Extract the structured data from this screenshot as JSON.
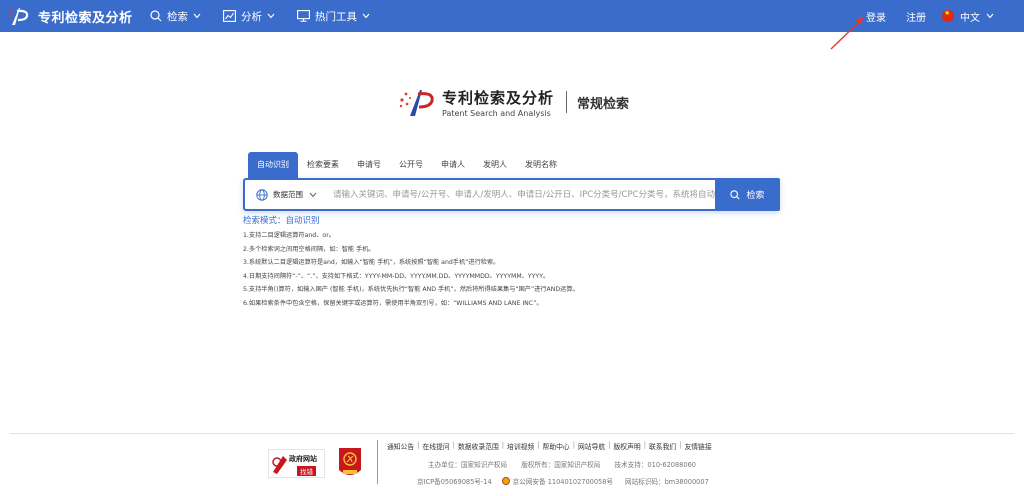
{
  "header": {
    "brand": "专利检索及分析",
    "nav": [
      {
        "label": "检索"
      },
      {
        "label": "分析"
      },
      {
        "label": "热门工具"
      }
    ],
    "login": "登录",
    "register": "注册",
    "language": "中文"
  },
  "logo": {
    "title_cn": "专利检索及分析",
    "title_en": "Patent Search and Analysis",
    "subtitle": "常规检索"
  },
  "tabs": [
    "自动识别",
    "检索要素",
    "申请号",
    "公开号",
    "申请人",
    "发明人",
    "发明名称"
  ],
  "search": {
    "scope_label": "数据范围",
    "placeholder": "请输入关键词、申请号/公开号、申请人/发明人、申请日/公开日、IPC分类号/CPC分类号，系统将自动识别",
    "button": "检索"
  },
  "mode": "检索模式：自动识别",
  "tips": [
    "1.支持二目逻辑运算符and、or。",
    "2.多个检索词之间用空格间隔，如：智能 手机。",
    "3.系统默认二目逻辑运算符是and，如输入“智能 手机”，系统按照“智能 and手机”进行检索。",
    "4.日期支持间隔符“-”、“.”，支持如下格式：YYYY-MM-DD、YYYY.MM.DD、YYYYMMDD、YYYYMM、YYYY。",
    "5.支持半角()算符，如输入国产 (智能 手机)，系统优先执行“智能 AND 手机”，然后将所得结果集与“国产”进行AND运算。",
    "6.如果检索条件中包含空格，保留关键字或运算符，需使用半角双引号，如：“WILLIAMS AND LANE INC”。"
  ],
  "footer": {
    "gov_badge_line1": "政府网站",
    "gov_badge_line2": "找错",
    "links": [
      "通知公告",
      "在线提问",
      "数据收录范围",
      "培训视频",
      "帮助中心",
      "网站导航",
      "版权声明",
      "联系我们",
      "友情链接"
    ],
    "sponsor": "主办单位：国家知识产权局",
    "copyright": "版权所有：国家知识产权局",
    "support": "技术支持：010-62088060",
    "icp": "京ICP备05069085号-14",
    "police": "京公网安备 11040102700058号",
    "site_code": "网站标识码：bm38000007"
  },
  "colors": {
    "primary": "#3a6ccc",
    "arrow": "#e8372c"
  }
}
